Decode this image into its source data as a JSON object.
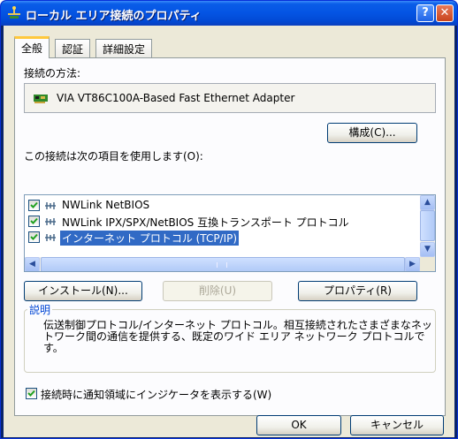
{
  "window": {
    "title": "ローカル エリア接続のプロパティ",
    "help_button": "?",
    "close_button": "✕"
  },
  "tabs": [
    {
      "label": "全般",
      "active": true
    },
    {
      "label": "認証",
      "active": false
    },
    {
      "label": "詳細設定",
      "active": false
    }
  ],
  "general": {
    "connect_using_label": "接続の方法:",
    "adapter_name": "VIA VT86C100A-Based Fast Ethernet Adapter",
    "configure_button": "構成(C)...",
    "items_label": "この接続は次の項目を使用します(O):",
    "items": [
      {
        "label": "NWLink NetBIOS",
        "checked": true,
        "selected": false
      },
      {
        "label": "NWLink IPX/SPX/NetBIOS 互換トランスポート プロトコル",
        "checked": true,
        "selected": false
      },
      {
        "label": "インターネット プロトコル (TCP/IP)",
        "checked": true,
        "selected": true
      }
    ],
    "install_button": "インストール(N)...",
    "uninstall_button": "削除(U)",
    "properties_button": "プロパティ(R)",
    "description_title": "説明",
    "description_text": "伝送制御プロトコル/インターネット プロトコル。相互接続されたさまざまなネットワーク間の通信を提供する、既定のワイド エリア ネットワーク プロトコルです。",
    "show_icon_label": "接続時に通知領域にインジケータを表示する(W)",
    "show_icon_checked": true
  },
  "footer": {
    "ok_button": "OK",
    "cancel_button": "キャンセル"
  },
  "colors": {
    "titlebar": "#0454e3",
    "dialog_bg": "#ece9d8",
    "selection": "#316ac5",
    "group_title": "#0046d5"
  }
}
